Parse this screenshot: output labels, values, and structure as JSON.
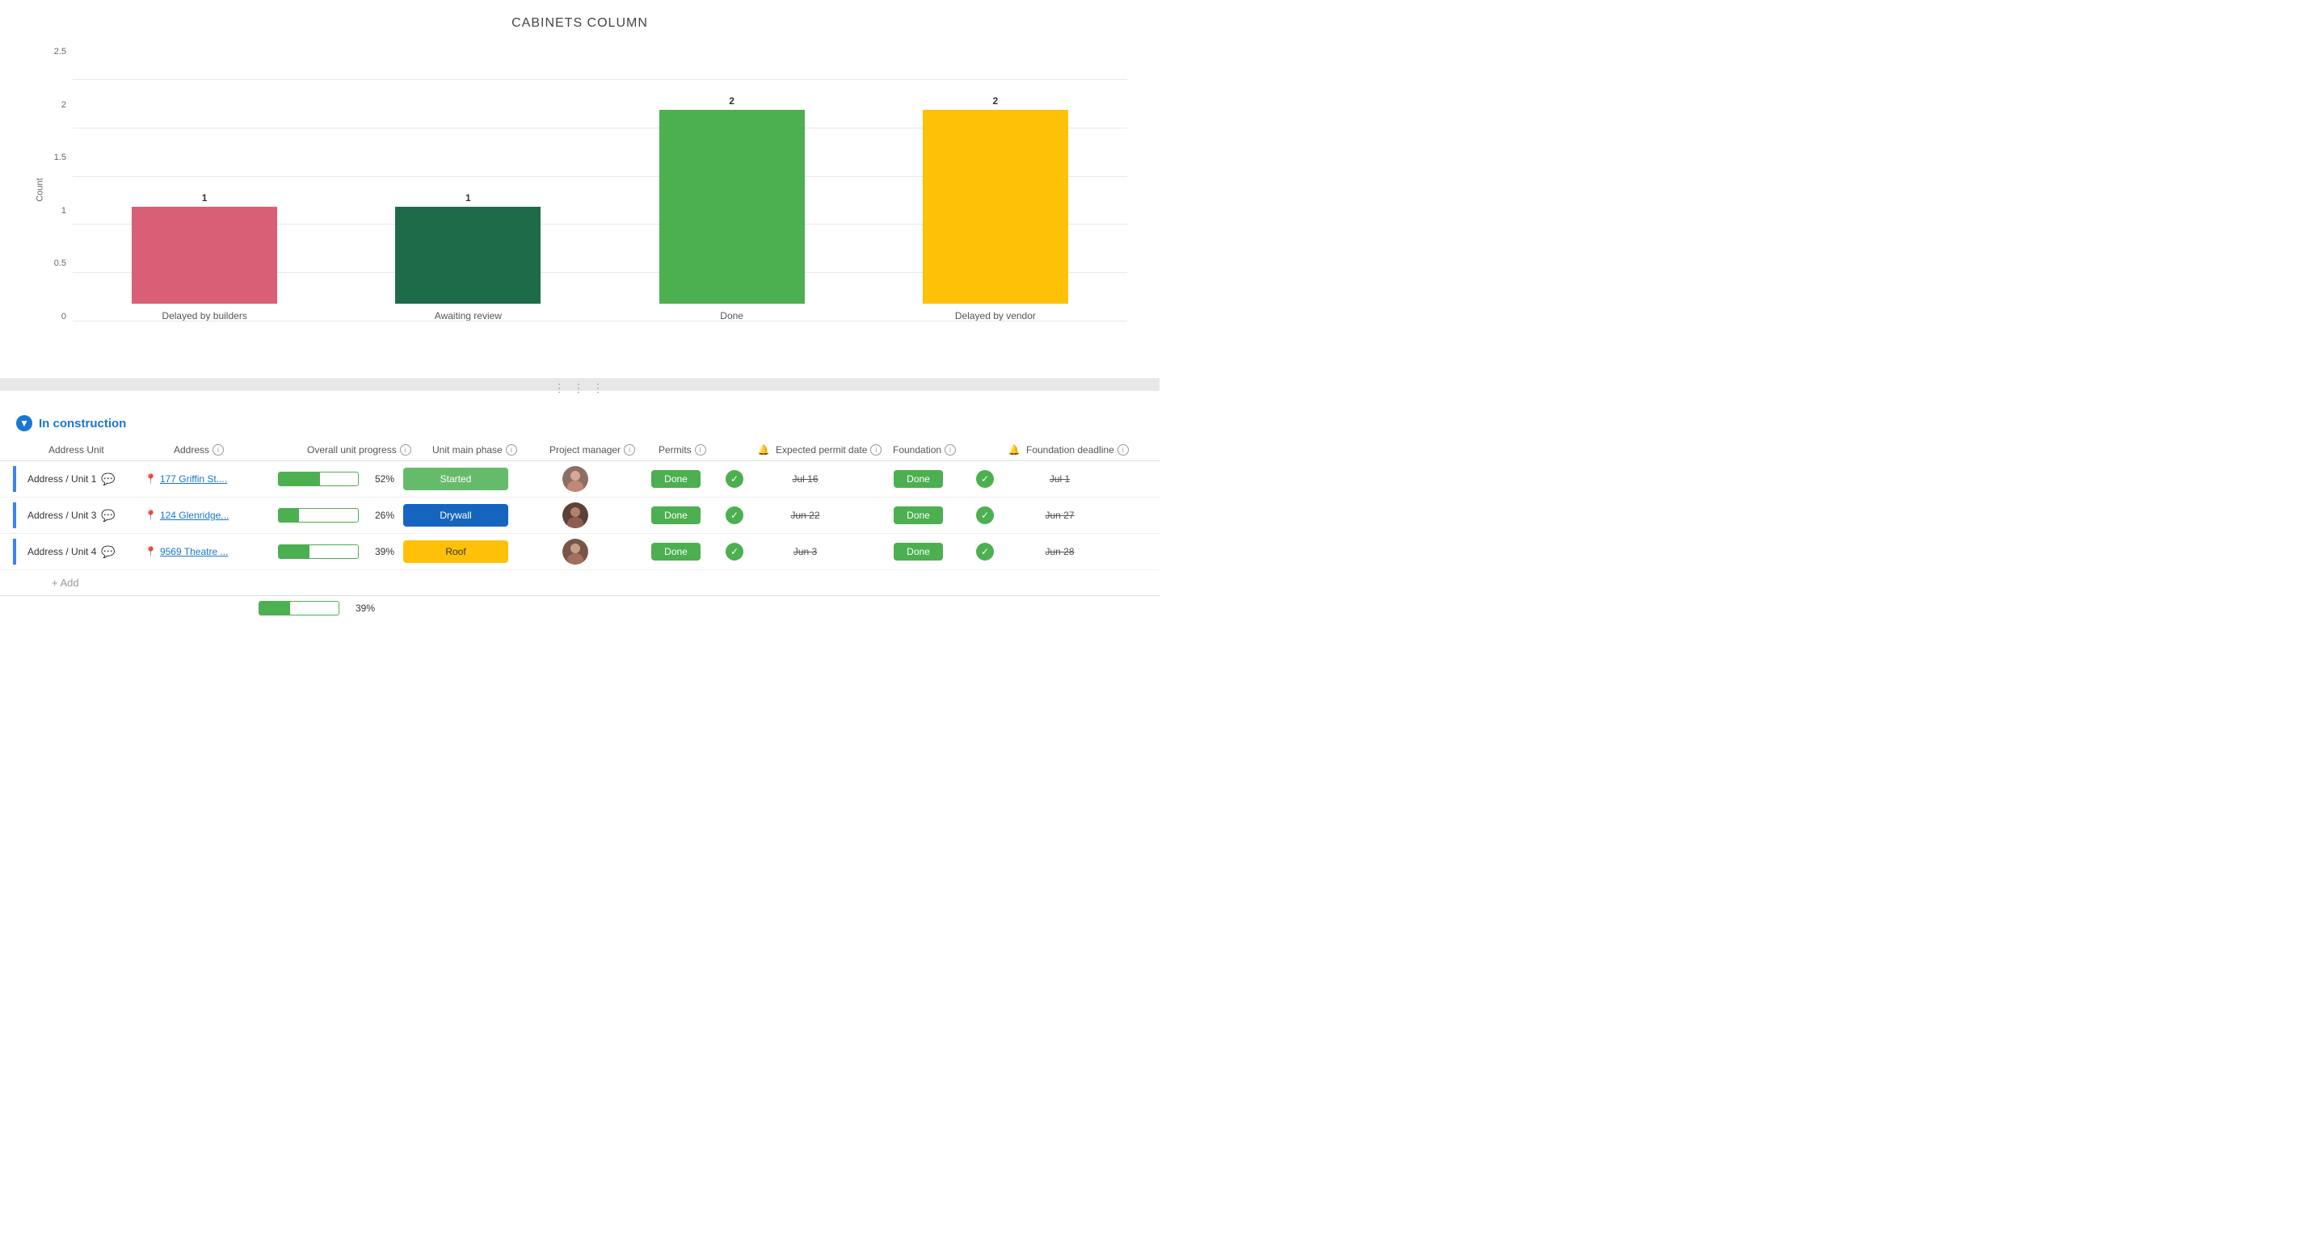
{
  "chart": {
    "title": "CABINETS COLUMN",
    "y_axis_label": "Count",
    "y_labels": [
      "2.5",
      "2",
      "1.5",
      "1",
      "0.5",
      "0"
    ],
    "bars": [
      {
        "label": "Delayed by builders",
        "value": 1,
        "color": "#d95f76",
        "height_pct": 40
      },
      {
        "label": "Awaiting review",
        "value": 1,
        "color": "#1e6b4a",
        "height_pct": 40
      },
      {
        "label": "Done",
        "value": 2,
        "color": "#4caf50",
        "height_pct": 80
      },
      {
        "label": "Delayed by vendor",
        "value": 2,
        "color": "#ffc107",
        "height_pct": 80
      }
    ]
  },
  "divider": {
    "dots": "⋮⋮⋮"
  },
  "table": {
    "group_name": "In construction",
    "columns": [
      {
        "label": "Address",
        "has_info": true,
        "has_bell": false
      },
      {
        "label": "Overall unit progress",
        "has_info": true,
        "has_bell": false
      },
      {
        "label": "Unit main phase",
        "has_info": true,
        "has_bell": false
      },
      {
        "label": "Project manager",
        "has_info": true,
        "has_bell": false
      },
      {
        "label": "Permits",
        "has_info": true,
        "has_bell": false
      },
      {
        "label": "Expected permit date",
        "has_info": true,
        "has_bell": true
      },
      {
        "label": "Foundation",
        "has_info": true,
        "has_bell": false
      },
      {
        "label": "Foundation deadline",
        "has_info": true,
        "has_bell": true
      }
    ],
    "rows": [
      {
        "name": "Address / Unit 1",
        "address": "177 Griffin St....",
        "progress_pct": 52,
        "phase": "Started",
        "phase_color": "#66bb6a",
        "permits": "Done",
        "permits_color": "#4caf50",
        "permit_date": "Jul 16",
        "foundation": "Done",
        "foundation_color": "#4caf50",
        "foundation_deadline": "Jul 1",
        "avatar_color": "#8d6e63"
      },
      {
        "name": "Address / Unit 3",
        "address": "124 Glenridge...",
        "progress_pct": 26,
        "phase": "Drywall",
        "phase_color": "#1565c0",
        "permits": "Done",
        "permits_color": "#4caf50",
        "permit_date": "Jun 22",
        "foundation": "Done",
        "foundation_color": "#4caf50",
        "foundation_deadline": "Jun 27",
        "avatar_color": "#5d4037"
      },
      {
        "name": "Address / Unit 4",
        "address": "9569 Theatre ...",
        "progress_pct": 39,
        "phase": "Roof",
        "phase_color": "#ffc107",
        "permits": "Done",
        "permits_color": "#4caf50",
        "permit_date": "Jun 3",
        "foundation": "Done",
        "foundation_color": "#4caf50",
        "foundation_deadline": "Jun 28",
        "avatar_color": "#795548"
      }
    ],
    "add_label": "+ Add",
    "summary_progress_pct": 39
  }
}
